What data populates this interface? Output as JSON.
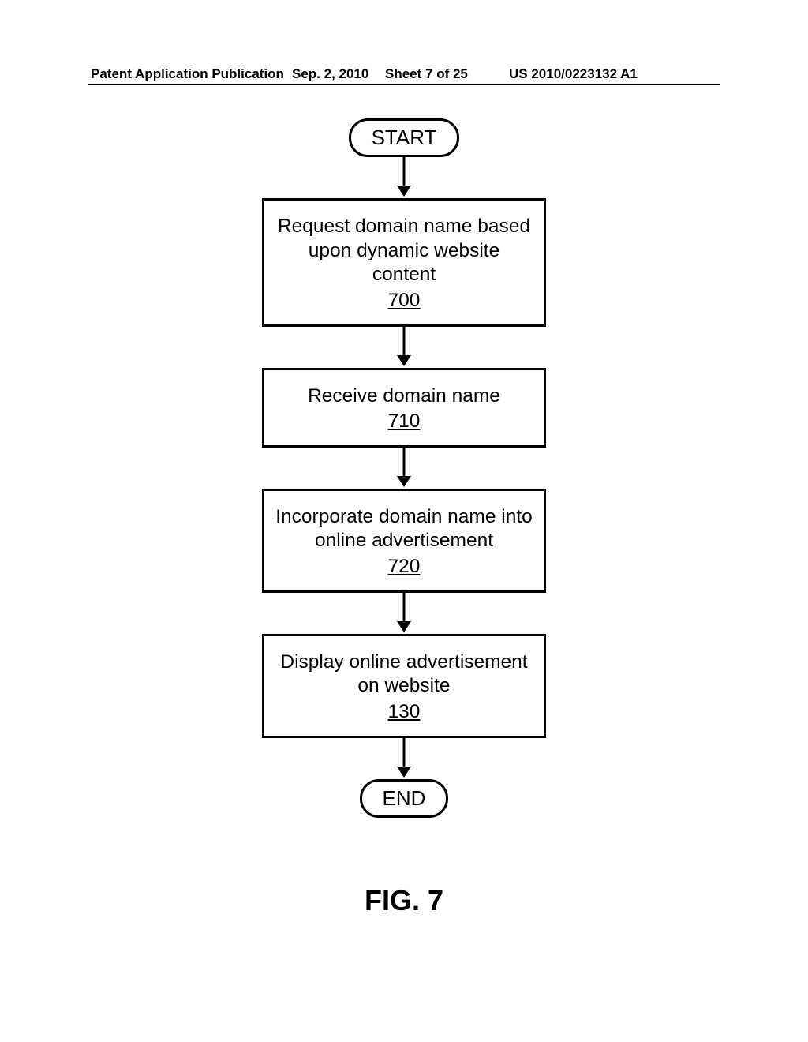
{
  "header": {
    "left": "Patent Application Publication",
    "date": "Sep. 2, 2010",
    "sheet": "Sheet 7 of 25",
    "pubno": "US 2010/0223132 A1"
  },
  "flowchart": {
    "start": "START",
    "end": "END",
    "steps": [
      {
        "text": "Request domain name based upon dynamic website content",
        "num": "700"
      },
      {
        "text": "Receive domain name",
        "num": "710"
      },
      {
        "text": "Incorporate domain name into online advertisement",
        "num": "720"
      },
      {
        "text": "Display online advertisement on website",
        "num": "130"
      }
    ]
  },
  "figure_label": "FIG. 7"
}
